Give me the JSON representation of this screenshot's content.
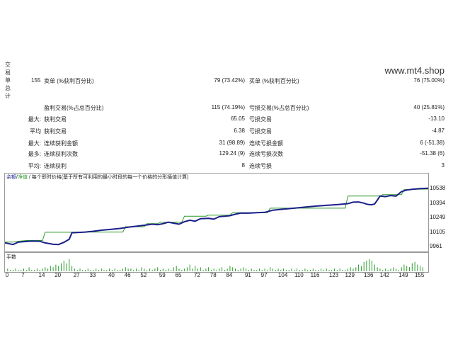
{
  "side_title": [
    "交",
    "易",
    "单",
    "总",
    "计"
  ],
  "watermark": "www.mt4.shop",
  "summary": {
    "total_trades": "155",
    "sell_label": "卖单 (%获利百分比)",
    "sell_value": "79 (73.42%)",
    "buy_label": "买单 (%获利百分比)",
    "buy_value": "76 (75.00%)",
    "profit_trades_label": "盈利交易(%占总百分比)",
    "profit_trades_value": "115 (74.19%)",
    "loss_trades_label": "亏损交易(%占总百分比)",
    "loss_trades_value": "40 (25.81%)"
  },
  "rows": [
    {
      "prefix": "最大:",
      "left_label": "获利交易",
      "left_value": "65.05",
      "right_label": "亏损交易",
      "right_value": "-13.10"
    },
    {
      "prefix": "平均",
      "left_label": "获利交易",
      "left_value": "6.38",
      "right_label": "亏损交易",
      "right_value": "-4.87"
    },
    {
      "prefix": "最大:",
      "left_label": "连续获利金额",
      "left_value": "31 (98.89)",
      "right_label": "连续亏损金额",
      "right_value": "6 (-51.38)"
    },
    {
      "prefix": "最多:",
      "left_label": "连续获利次数",
      "left_value": "129.24 (9)",
      "right_label": "连续亏损次数",
      "right_value": "-51.38 (6)"
    },
    {
      "prefix": "平均:",
      "left_label": "连续获利",
      "left_value": "8",
      "right_label": "连续亏损",
      "right_value": "3"
    }
  ],
  "chart": {
    "legend_balance": "余额",
    "legend_separator": "/",
    "legend_equity": "净值",
    "legend_desc": "/ 每个即时价格(基于所有可利用的最小时段的每一个价格的分形插值计算)",
    "volume_label": "手数",
    "balance_color": "#1b1f8a",
    "equity_color": "#2b9a2b",
    "volume_color": "#2b9a2b"
  },
  "chart_data": {
    "type": "line",
    "ylim": [
      9961,
      10610
    ],
    "xlim": [
      0,
      158
    ],
    "y_ticks": [
      "10538",
      "10394",
      "10249",
      "10105",
      "9961"
    ],
    "x_ticks": [
      "0",
      "7",
      "14",
      "20",
      "27",
      "33",
      "40",
      "46",
      "52",
      "59",
      "65",
      "72",
      "78",
      "84",
      "91",
      "97",
      "104",
      "110",
      "116",
      "123",
      "129",
      "136",
      "142",
      "149",
      "155"
    ],
    "series": [
      {
        "name": "余额",
        "x": [
          0,
          3,
          5,
          8,
          10,
          13,
          15,
          18,
          20,
          22,
          24,
          25,
          27,
          30,
          33,
          36,
          40,
          43,
          46,
          49,
          52,
          55,
          57,
          59,
          61,
          63,
          65,
          67,
          69,
          71,
          73,
          76,
          78,
          80,
          82,
          84,
          86,
          88,
          91,
          94,
          97,
          100,
          104,
          108,
          112,
          116,
          120,
          124,
          128,
          130,
          132,
          134,
          135,
          136,
          137,
          138,
          139,
          140,
          141,
          142,
          143,
          144,
          146,
          148,
          150,
          152,
          155,
          158
        ],
        "values": [
          10005,
          9988,
          10012,
          10018,
          10022,
          10020,
          10004,
          9990,
          9988,
          10010,
          10040,
          10105,
          10107,
          10112,
          10120,
          10130,
          10140,
          10148,
          10160,
          10170,
          10180,
          10190,
          10185,
          10195,
          10210,
          10200,
          10190,
          10215,
          10230,
          10220,
          10245,
          10248,
          10240,
          10265,
          10270,
          10275,
          10290,
          10300,
          10300,
          10305,
          10308,
          10330,
          10340,
          10350,
          10360,
          10370,
          10378,
          10385,
          10395,
          10410,
          10412,
          10400,
          10390,
          10385,
          10384,
          10392,
          10430,
          10470,
          10468,
          10465,
          10470,
          10475,
          10470,
          10515,
          10530,
          10538,
          10545,
          10548
        ]
      },
      {
        "name": "净值",
        "x": [
          0,
          3,
          5,
          8,
          10,
          14,
          15,
          25,
          26,
          44,
          45,
          52,
          53,
          57,
          58,
          66,
          67,
          75,
          76,
          84,
          85,
          98,
          99,
          127,
          128,
          134,
          135,
          140,
          141,
          148,
          149,
          158
        ],
        "values": [
          10012,
          10012,
          10020,
          10028,
          10028,
          10028,
          10110,
          10110,
          10112,
          10112,
          10165,
          10165,
          10195,
          10195,
          10210,
          10210,
          10270,
          10270,
          10280,
          10280,
          10305,
          10305,
          10350,
          10350,
          10470,
          10470,
          10470,
          10470,
          10485,
          10485,
          10535,
          10540
        ]
      }
    ],
    "volume": [
      2,
      1,
      1,
      2,
      1,
      1,
      2,
      1,
      3,
      1,
      1,
      2,
      1,
      2,
      3,
      2,
      4,
      3,
      5,
      4,
      6,
      8,
      6,
      9,
      4,
      2,
      1,
      2,
      1,
      1,
      2,
      1,
      1,
      2,
      1,
      2,
      1,
      1,
      2,
      1,
      2,
      1,
      1,
      2,
      3,
      2,
      2,
      1,
      2,
      1,
      3,
      2,
      1,
      2,
      1,
      2,
      3,
      1,
      2,
      1,
      2,
      1,
      3,
      4,
      2,
      1,
      2,
      3,
      5,
      2,
      4,
      2,
      3,
      1,
      2,
      3,
      1,
      2,
      1,
      2,
      3,
      1,
      2,
      4,
      3,
      2,
      1,
      2,
      3,
      2,
      1,
      2,
      1,
      1,
      2,
      1,
      2,
      1,
      3,
      2,
      1,
      2,
      1,
      2,
      1,
      1,
      2,
      1,
      2,
      1,
      1,
      2,
      1,
      1,
      2,
      1,
      1,
      2,
      1,
      2,
      1,
      1,
      2,
      1,
      2,
      1,
      1,
      2,
      3,
      2,
      3,
      5,
      4,
      7,
      8,
      9,
      8,
      5,
      3,
      2,
      1,
      2,
      1,
      2,
      3,
      2,
      1,
      3,
      5,
      4,
      3,
      6,
      7,
      5,
      4,
      3
    ]
  }
}
